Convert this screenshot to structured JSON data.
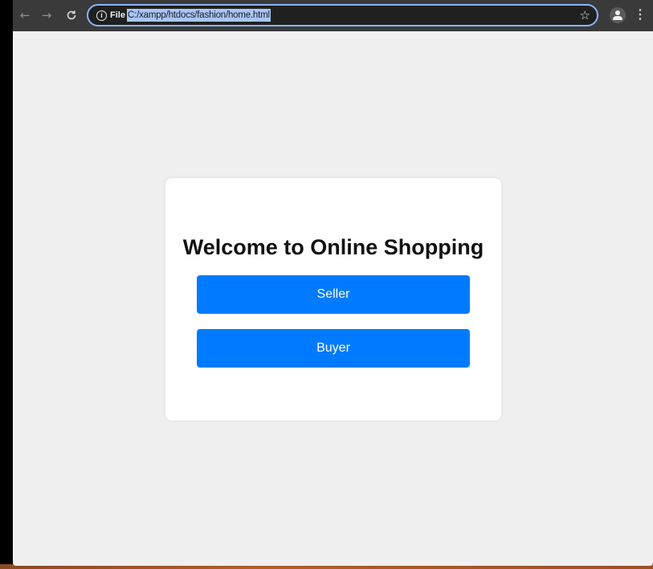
{
  "browser": {
    "nav": {
      "back_icon": "←",
      "forward_icon": "→",
      "reload_icon": "C"
    },
    "address_bar": {
      "chip_label": "File",
      "url": "C:/xampp/htdocs/fashion/home.html"
    },
    "icons": {
      "info": "i",
      "star": "☆",
      "menu": "⋮"
    }
  },
  "page": {
    "title": "Welcome to Online Shopping",
    "buttons": {
      "seller": "Seller",
      "buyer": "Buyer"
    }
  },
  "colors": {
    "accent": "#007bff",
    "page_background": "#f0f0f0",
    "toolbar": "#3a3a3a",
    "omnibox_border": "#8ab4f8",
    "url_selection": "#a8c7fa"
  }
}
